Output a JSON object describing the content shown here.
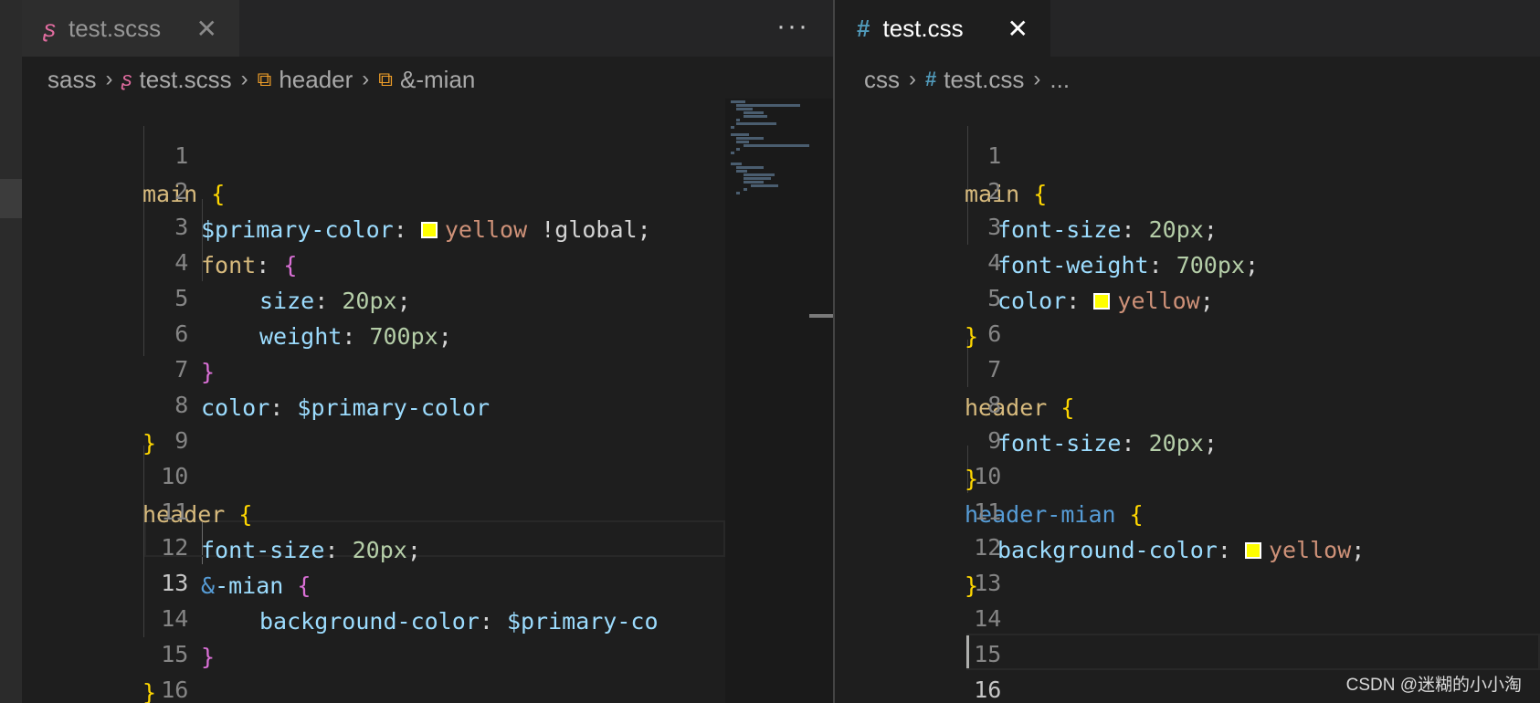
{
  "left": {
    "tab": {
      "label": "test.scss",
      "icon": "sass-icon",
      "close": "✕"
    },
    "more_actions": "···",
    "breadcrumb": [
      "sass",
      "test.scss",
      "header",
      "&-mian"
    ],
    "line_numbers": [
      "1",
      "2",
      "3",
      "4",
      "5",
      "6",
      "7",
      "8",
      "9",
      "10",
      "11",
      "12",
      "13",
      "14",
      "15",
      "16"
    ],
    "current_line": "13",
    "code": {
      "l1": {
        "sel": "main",
        "br": "{"
      },
      "l2": {
        "var": "$primary-color",
        "colon": ":",
        "val": "yellow",
        "flag": "!global;"
      },
      "l3": {
        "prop": "font",
        "colon": ":",
        "br": "{"
      },
      "l4": {
        "prop": "size",
        "colon": ":",
        "val": "20px",
        "semi": ";"
      },
      "l5": {
        "prop": "weight",
        "colon": ":",
        "val": "700px",
        "semi": ";"
      },
      "l6": {
        "br": "}"
      },
      "l7": {
        "prop": "color",
        "colon": ":",
        "var": "$primary-color"
      },
      "l8": {
        "br": "}"
      },
      "l10": {
        "sel": "header",
        "br": "{"
      },
      "l11": {
        "prop": "font-size",
        "colon": ":",
        "val": "20px",
        "semi": ";"
      },
      "l12": {
        "amp": "&",
        "sel": "-mian",
        "br": "{"
      },
      "l13": {
        "prop": "background-color",
        "colon": ":",
        "var": "$primary-co"
      },
      "l14": {
        "br": "}"
      },
      "l15": {
        "br": "}"
      }
    }
  },
  "right": {
    "tab": {
      "label": "test.css",
      "icon": "#",
      "close": "✕"
    },
    "breadcrumb": [
      "css",
      "test.css",
      "..."
    ],
    "line_numbers": [
      "1",
      "2",
      "3",
      "4",
      "5",
      "6",
      "7",
      "8",
      "9",
      "10",
      "11",
      "12",
      "13",
      "14",
      "15",
      "16"
    ],
    "current_line": "16",
    "code": {
      "l1": {
        "sel": "main",
        "br": "{"
      },
      "l2": {
        "prop": "font-size",
        "colon": ":",
        "val": "20px",
        "semi": ";"
      },
      "l3": {
        "prop": "font-weight",
        "colon": ":",
        "val": "700px",
        "semi": ";"
      },
      "l4": {
        "prop": "color",
        "colon": ":",
        "val": "yellow",
        "semi": ";"
      },
      "l5": {
        "br": "}"
      },
      "l7": {
        "sel": "header",
        "br": "{"
      },
      "l8": {
        "prop": "font-size",
        "colon": ":",
        "val": "20px",
        "semi": ";"
      },
      "l9": {
        "br": "}"
      },
      "l10": {
        "sel": "header-mian",
        "br": "{"
      },
      "l11": {
        "prop": "background-color",
        "colon": ":",
        "val": "yellow",
        "semi": ";"
      },
      "l12": {
        "br": "}"
      }
    }
  },
  "watermark": "CSDN @迷糊的小小淘",
  "colors": {
    "swatch": "#ffff00",
    "bracket_level1": "#ffd700",
    "bracket_level2": "#da70d6"
  }
}
